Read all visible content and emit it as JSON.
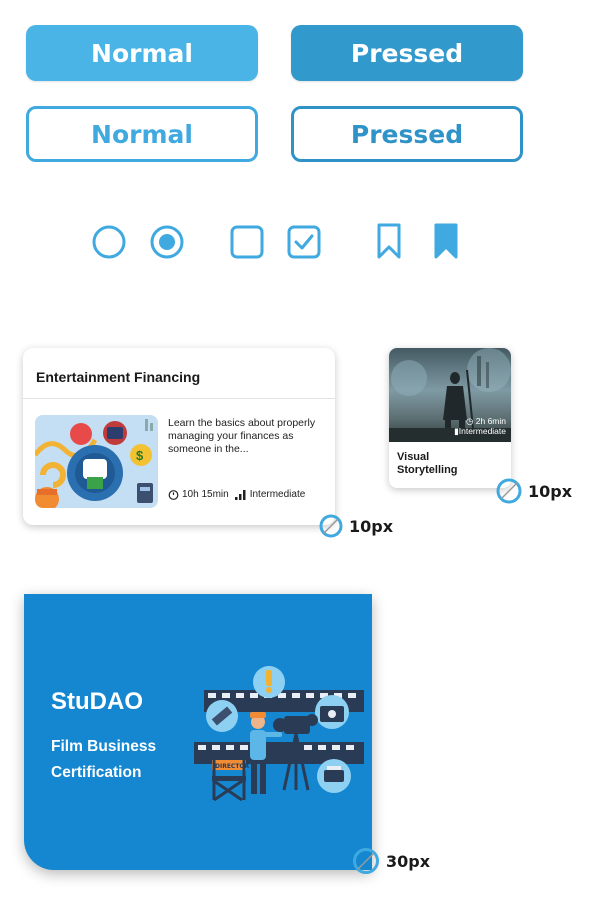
{
  "buttons": {
    "solid_normal": "Normal",
    "solid_pressed": "Pressed",
    "outline_normal": "Normal",
    "outline_pressed": "Pressed"
  },
  "controls": {
    "icons": [
      "radio-unchecked-icon",
      "radio-checked-icon",
      "checkbox-unchecked-icon",
      "checkbox-checked-icon",
      "bookmark-outline-icon",
      "bookmark-filled-icon"
    ],
    "color": "#3fa9e0"
  },
  "course_card": {
    "title": "Entertainment Financing",
    "description": "Learn the basics about properly managing your finances as someone in the...",
    "duration": "10h 15min",
    "level": "Intermediate",
    "radius_label": "10px"
  },
  "small_card": {
    "duration": "2h 6min",
    "level": "Intermediate",
    "title": "Visual Storytelling",
    "radius_label": "10px"
  },
  "banner": {
    "brand": "StuDAO",
    "subtitle": "Film Business Certification",
    "radius_label": "30px",
    "background": "#1587d1",
    "clapper_text": "DIRECTOR"
  },
  "colors": {
    "accent": "#4bb4e7",
    "accent_pressed": "#3199cc"
  }
}
